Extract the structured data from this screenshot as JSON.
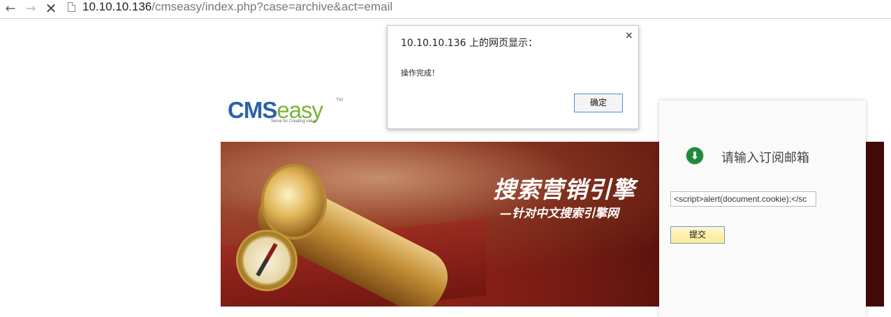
{
  "browser": {
    "url_host": "10.10.10.136",
    "url_path": "/cmseasy/index.php?case=archive&act=email",
    "back_icon": "←",
    "forward_icon": "→",
    "stop_icon": "✕"
  },
  "logo": {
    "cms": "CMS",
    "easy": "easy",
    "tm": "TM",
    "tagline": "Serve for Creating value"
  },
  "banner": {
    "title": "搜索营销引擎",
    "subtitle": "—针对中文搜索引擎网"
  },
  "subscribe": {
    "title": "请输入订阅邮箱",
    "input_value": "<script>alert(document.cookie);</sc",
    "submit_label": "提交",
    "icon_glyph": "⬇"
  },
  "dialog": {
    "title": "10.10.10.136 上的网页显示：",
    "message": "操作完成！",
    "ok_label": "确定",
    "close_glyph": "×"
  },
  "colors": {
    "logo_blue": "#2a62a8",
    "logo_green": "#7bb33b",
    "icon_green": "#1e8a3a",
    "button_border": "#4a90d9"
  }
}
